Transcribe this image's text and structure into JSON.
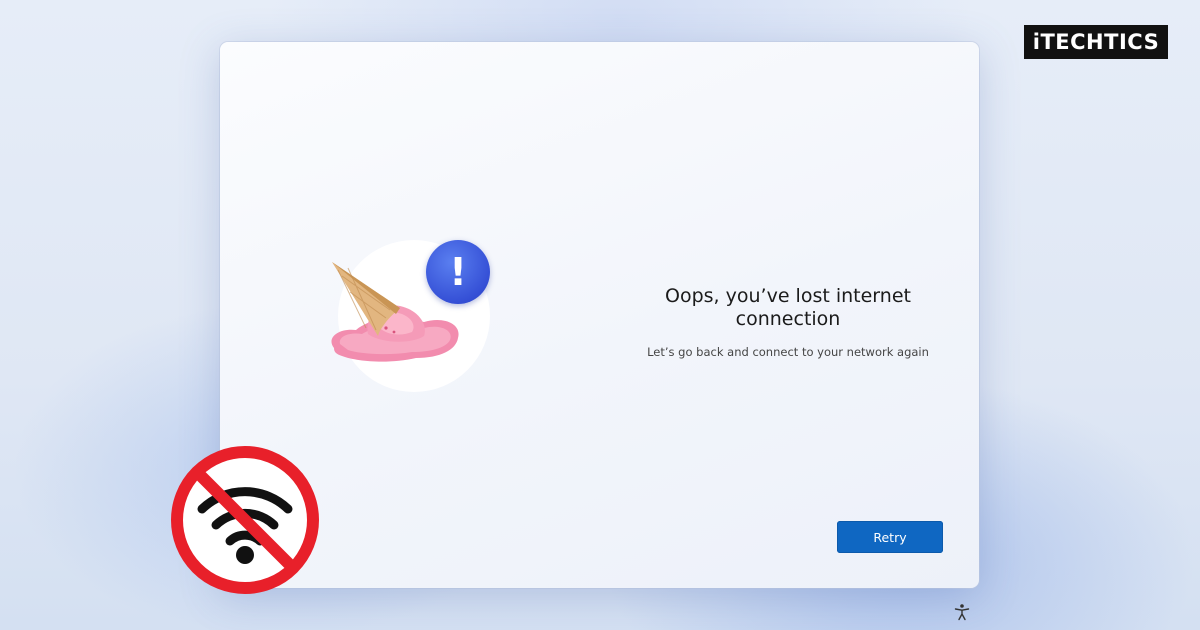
{
  "dialog": {
    "title": "Oops, you’ve lost internet connection",
    "subtitle": "Let’s go back and connect to your network again",
    "retry_label": "Retry"
  },
  "brand": {
    "logo_text": "iTECHTICS"
  },
  "icons": {
    "alert": "exclamation-icon",
    "illustration": "dropped-ice-cream-cone",
    "no_wifi": "no-wifi-icon",
    "accessibility": "accessibility-icon"
  },
  "colors": {
    "accent": "#0f67c2",
    "alert_badge": "#3a56da",
    "no_wifi_red": "#e8202a"
  }
}
